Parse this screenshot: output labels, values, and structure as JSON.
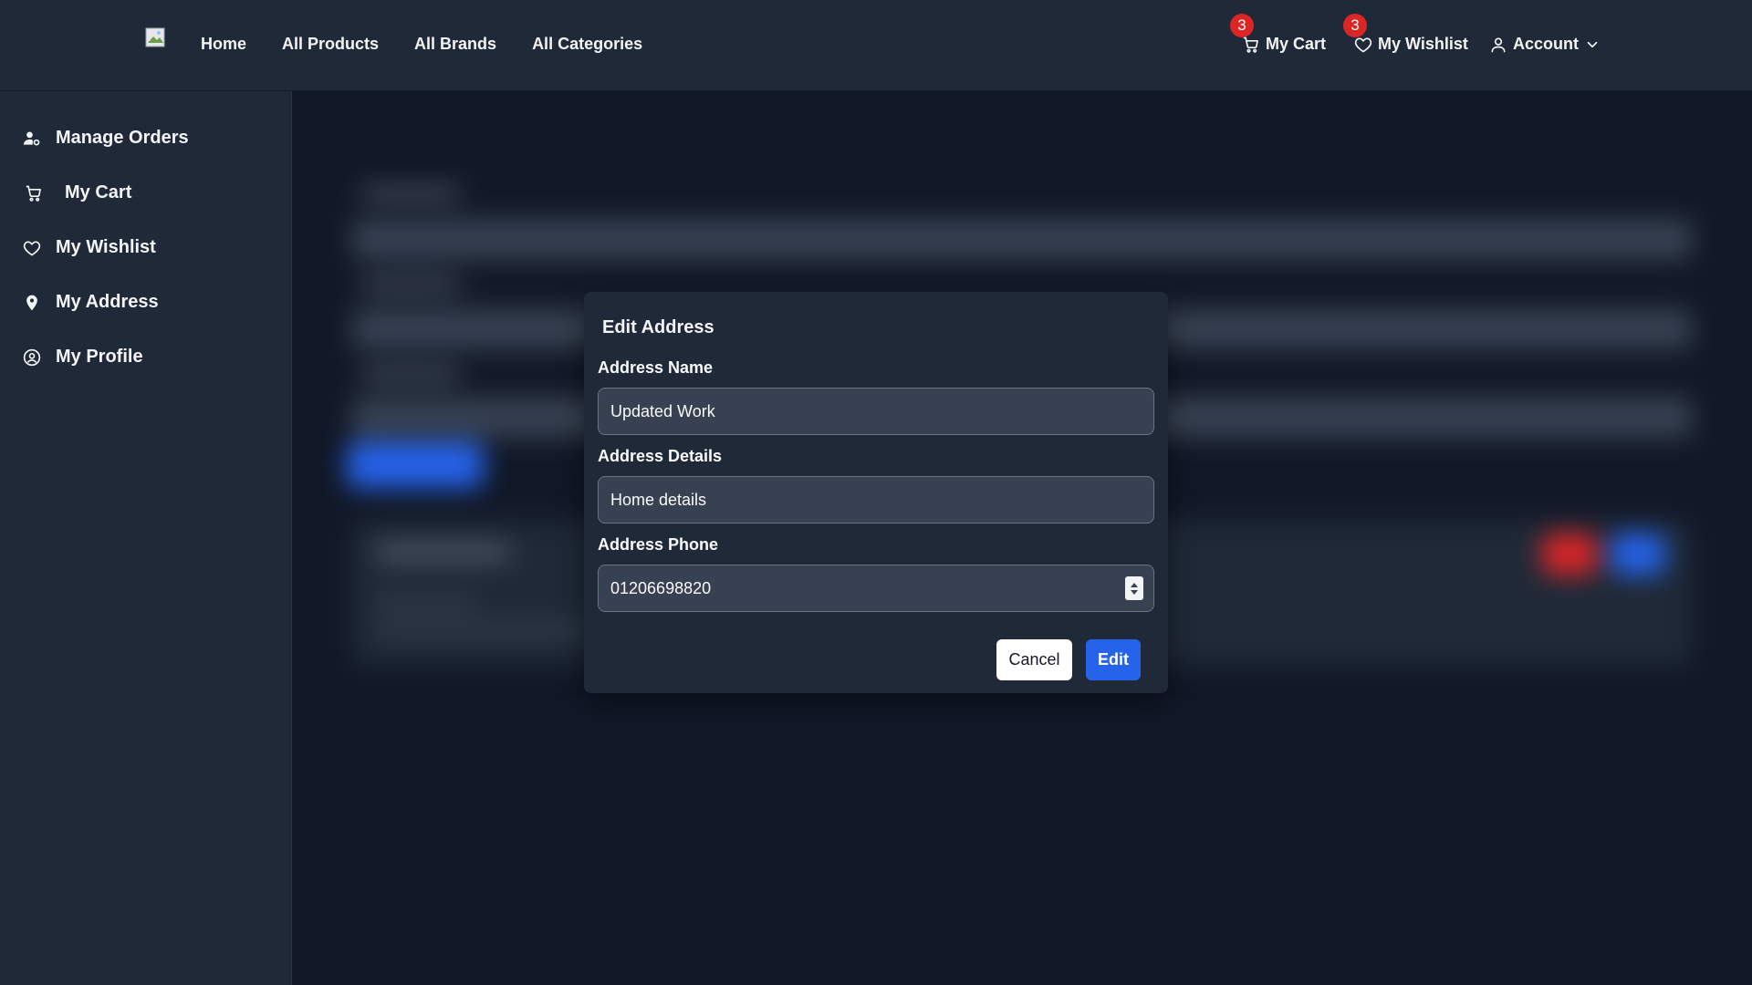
{
  "navbar": {
    "links": [
      "Home",
      "All Products",
      "All Brands",
      "All Categories"
    ],
    "cart": {
      "label": "My Cart",
      "count": "3",
      "icon": "cart-icon"
    },
    "wishlist": {
      "label": "My Wishlist",
      "count": "3",
      "icon": "heart-icon"
    },
    "account": {
      "label": "Account",
      "icon": "user-icon",
      "caret": "chevron-down-icon"
    }
  },
  "sidebar": {
    "items": [
      {
        "label": "Manage Orders",
        "icon": "users-gear-icon"
      },
      {
        "label": "My Cart",
        "icon": "cart-icon"
      },
      {
        "label": "My Wishlist",
        "icon": "heart-icon"
      },
      {
        "label": "My Address",
        "icon": "location-pin-icon"
      },
      {
        "label": "My Profile",
        "icon": "user-circle-icon"
      }
    ]
  },
  "modal": {
    "title": "Edit Address",
    "fields": {
      "name": {
        "label": "Address Name",
        "value": "Updated Work"
      },
      "details": {
        "label": "Address Details",
        "value": "Home details"
      },
      "phone": {
        "label": "Address Phone",
        "value": "01206698820"
      }
    },
    "cancel_label": "Cancel",
    "edit_label": "Edit"
  },
  "colors": {
    "page_bg": "#111827",
    "panel_bg": "#1f2937",
    "input_bg": "#374151",
    "primary": "#2563eb",
    "badge": "#dc2626"
  }
}
